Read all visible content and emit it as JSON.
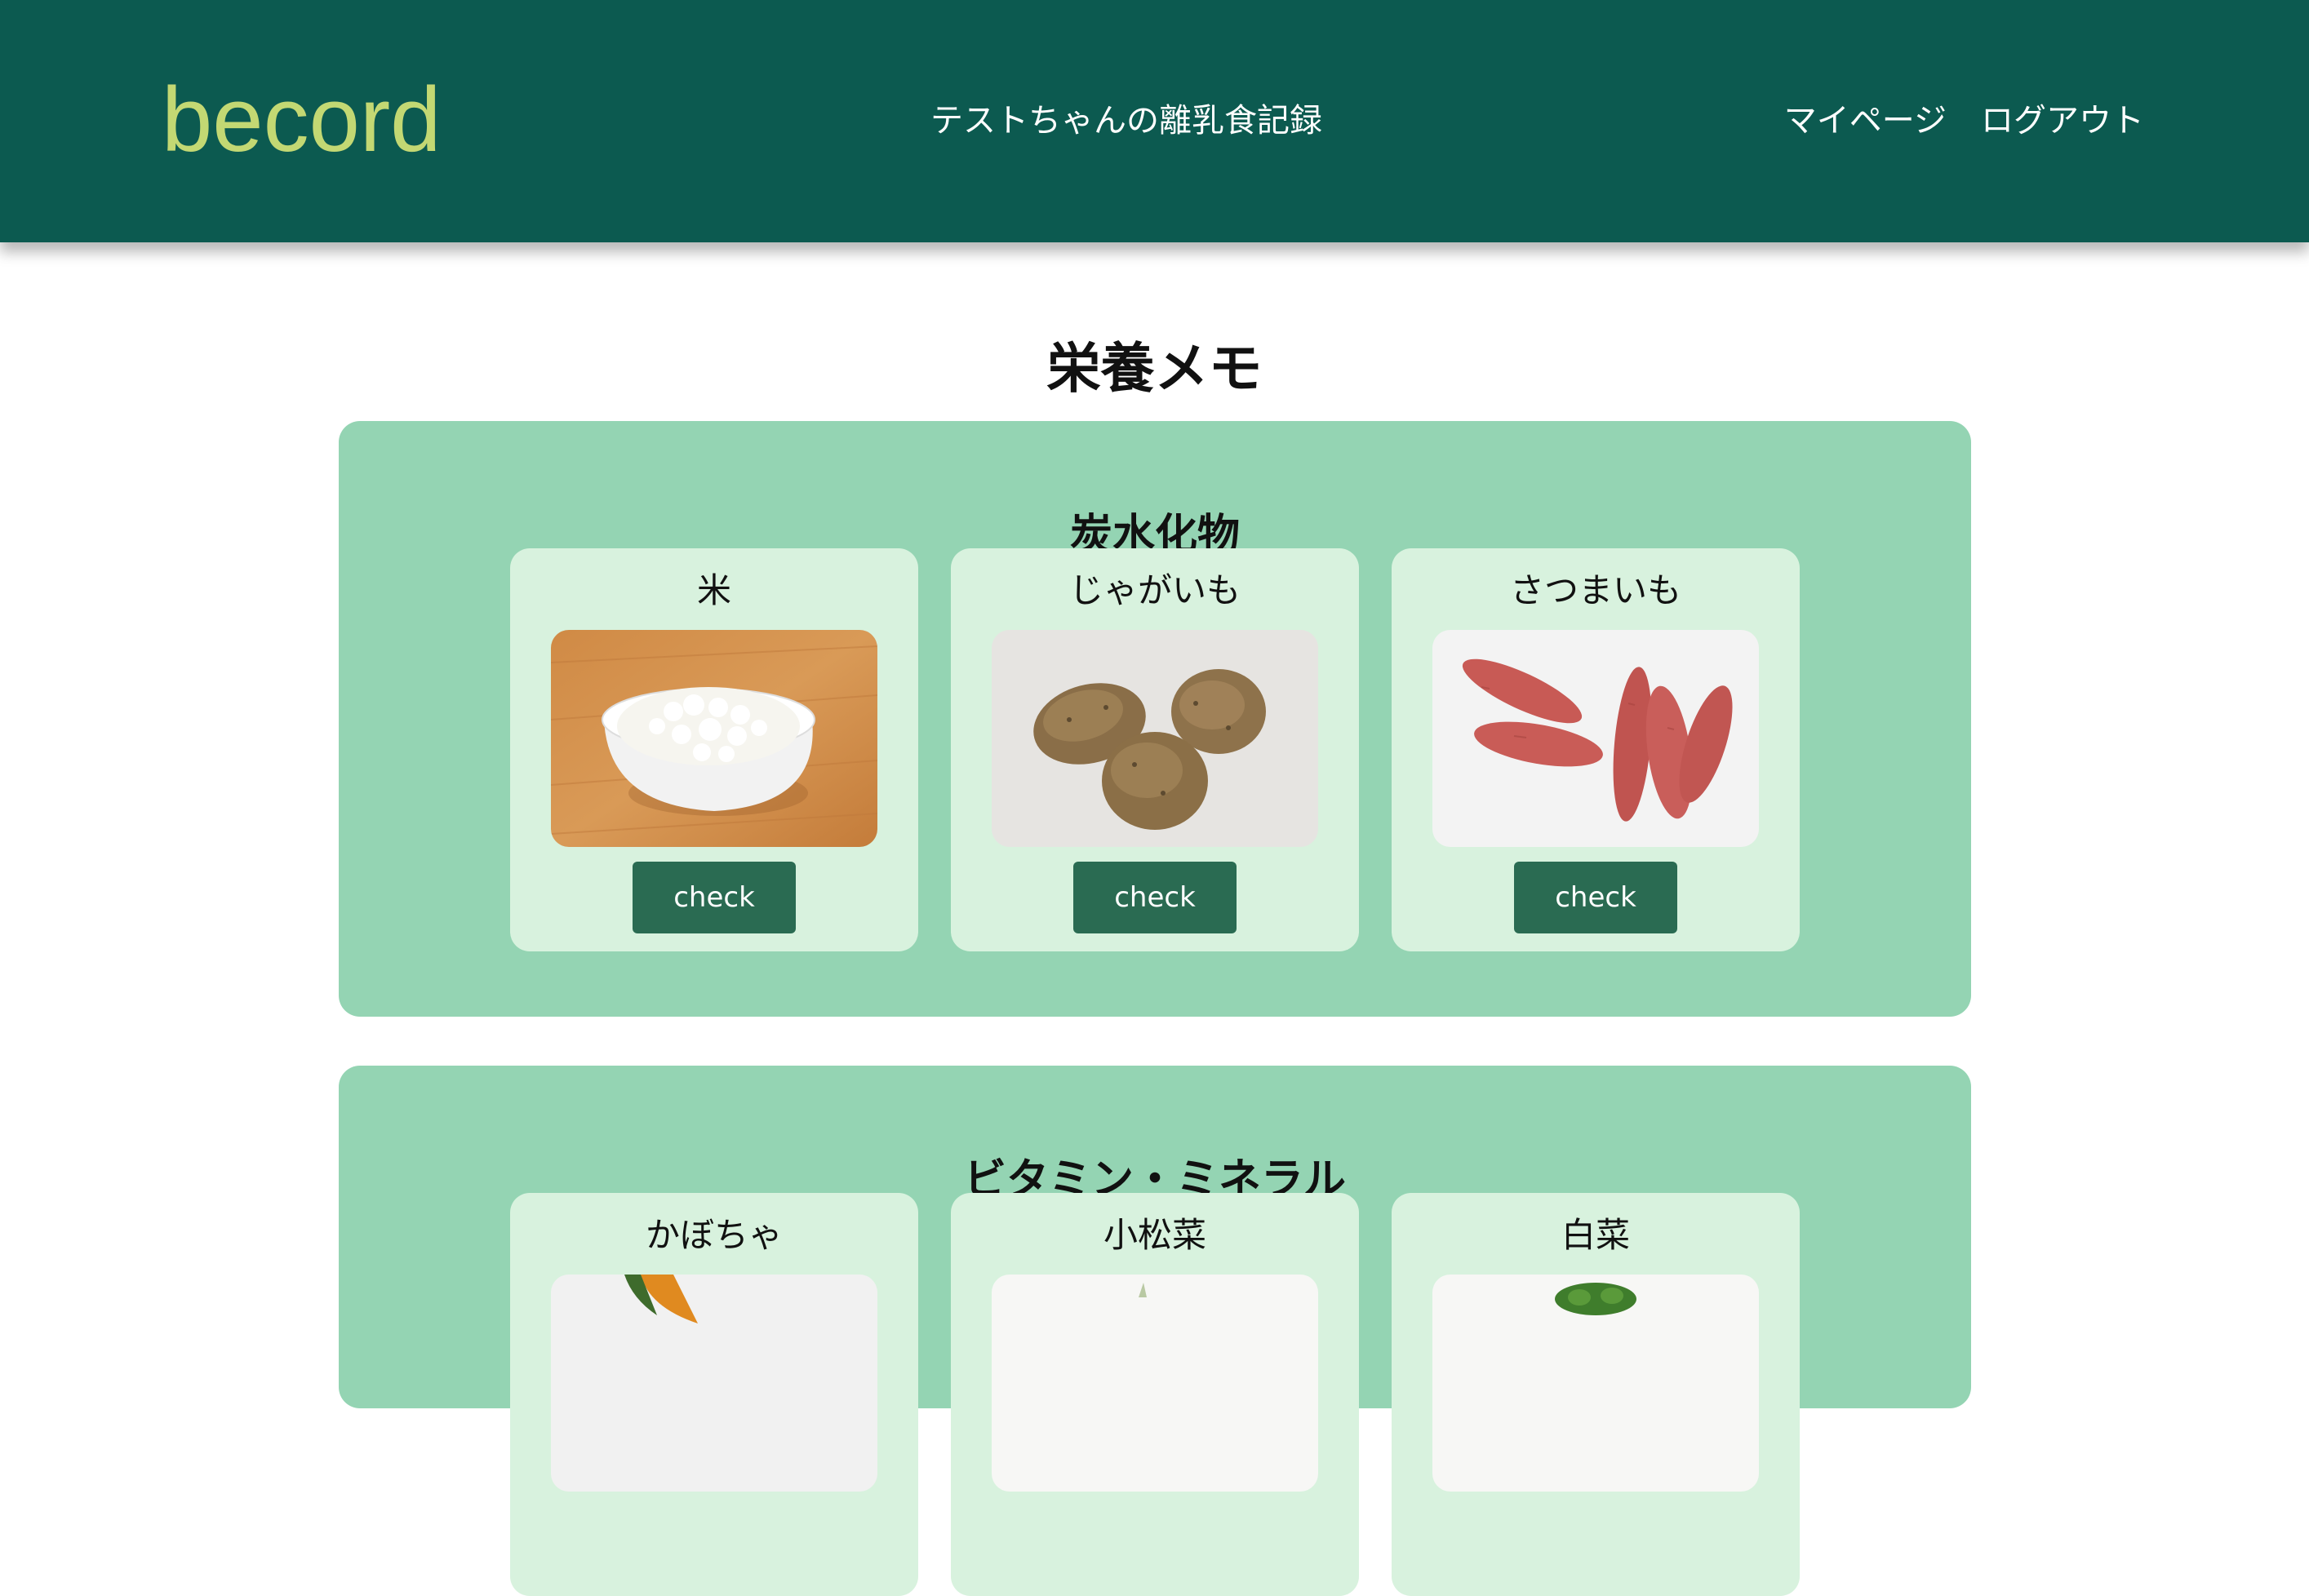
{
  "header": {
    "logo": "becord",
    "title": "テストちゃんの離乳食記録",
    "nav": {
      "mypage": "マイページ",
      "logout": "ログアウト"
    }
  },
  "page": {
    "title": "栄養メモ"
  },
  "colors": {
    "header_bg": "#0c5a50",
    "logo": "#c3d873",
    "category_bg": "#94d4b3",
    "card_bg": "#d8f2de",
    "button_bg": "#2a6b52"
  },
  "categories": [
    {
      "title": "炭水化物",
      "items": [
        {
          "name": "米",
          "image": "rice-bowl-photo",
          "button": "check"
        },
        {
          "name": "じゃがいも",
          "image": "potatoes-photo",
          "button": "check"
        },
        {
          "name": "さつまいも",
          "image": "sweet-potatoes-photo",
          "button": "check"
        }
      ]
    },
    {
      "title": "ビタミン・ミネラル",
      "items": [
        {
          "name": "かぼちゃ",
          "image": "pumpkin-photo"
        },
        {
          "name": "小松菜",
          "image": "komatsuna-photo"
        },
        {
          "name": "白菜",
          "image": "napa-cabbage-photo"
        }
      ]
    }
  ]
}
